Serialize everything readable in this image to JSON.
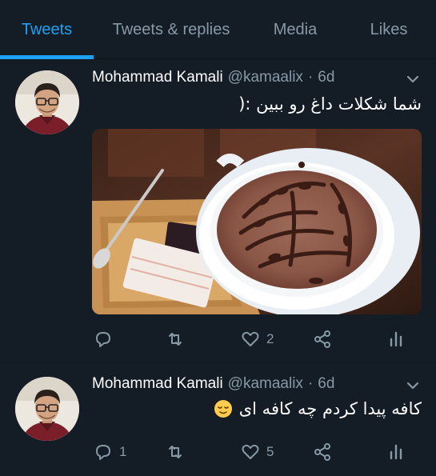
{
  "tabs": [
    {
      "label": "Tweets",
      "active": true
    },
    {
      "label": "Tweets & replies",
      "active": false
    },
    {
      "label": "Media",
      "active": false
    },
    {
      "label": "Likes",
      "active": false
    }
  ],
  "colors": {
    "accent": "#1da1f2",
    "background": "#141d26",
    "muted": "#8899a6"
  },
  "tweets": [
    {
      "name": "Mohammad Kamali",
      "handle": "@kamaalix",
      "separator": "·",
      "time": "6d",
      "text": "شما شکلات داغ رو ببین :(",
      "media": "hot-chocolate-latte-art-photo",
      "replies": "",
      "retweets": "",
      "likes": "2"
    },
    {
      "name": "Mohammad Kamali",
      "handle": "@kamaalix",
      "separator": "·",
      "time": "6d",
      "text": "کافه پیدا کردم چه کافه ای",
      "emoji": "relieved-face",
      "replies": "1",
      "retweets": "",
      "likes": "5"
    }
  ],
  "icons": {
    "reply": "reply-icon",
    "retweet": "retweet-icon",
    "like": "heart-icon",
    "share": "share-icon",
    "analytics": "analytics-icon",
    "caret": "chevron-down-icon"
  }
}
